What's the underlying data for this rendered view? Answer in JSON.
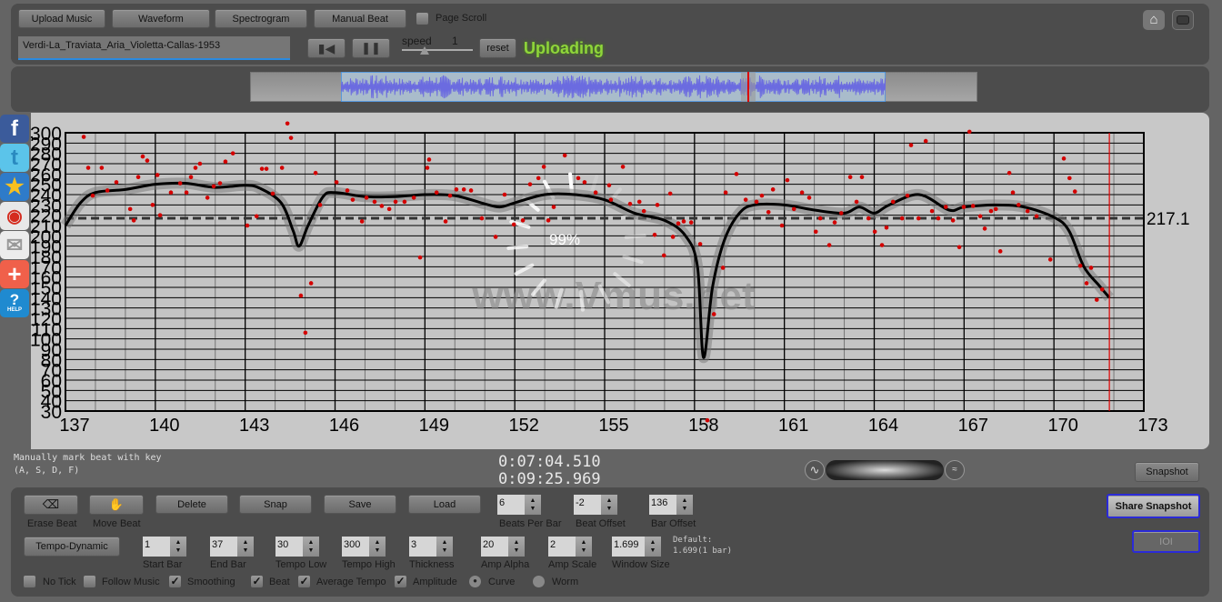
{
  "toolbar": {
    "upload_label": "Upload Music",
    "waveform_label": "Waveform",
    "spectrogram_label": "Spectrogram",
    "manual_beat_label": "Manual Beat",
    "page_scroll_label": "Page Scroll",
    "page_scroll_checked": false,
    "track_title": "Verdi-La_Traviata_Aria_Violetta-Callas-1953",
    "speed_label": "speed",
    "speed_value": "1",
    "reset_label": "reset",
    "status": "Uploading",
    "status_color": "#8fd63a"
  },
  "social": [
    "facebook-icon",
    "twitter-icon",
    "qzone-icon",
    "weibo-icon",
    "mail-icon",
    "add-icon",
    "help-icon"
  ],
  "social_help_text": "HELP",
  "overlay": {
    "progress": "99%",
    "watermark": "www.Vmus.net"
  },
  "info": {
    "hint_line1": "Manually mark beat with key",
    "hint_line2": "(A, S, D, F)",
    "current_time": "0:07:04.510",
    "total_time": "0:09:25.969",
    "snapshot_label": "Snapshot"
  },
  "controls": {
    "erase_beat": "Erase Beat",
    "move_beat": "Move Beat",
    "delete": "Delete",
    "snap": "Snap",
    "save": "Save",
    "load": "Load",
    "tempo_dynamic": "Tempo-Dynamic",
    "share_snapshot": "Share Snapshot",
    "ioi": "IOI",
    "default_line1": "Default:",
    "default_line2": "1.699(1 bar)",
    "spins1": [
      {
        "label": "Beats Per Bar",
        "value": "6"
      },
      {
        "label": "Beat Offset",
        "value": "-2"
      },
      {
        "label": "Bar Offset",
        "value": "136"
      }
    ],
    "spins2": [
      {
        "label": "Start Bar",
        "value": "1"
      },
      {
        "label": "End Bar",
        "value": "37"
      },
      {
        "label": "Tempo Low",
        "value": "30"
      },
      {
        "label": "Tempo High",
        "value": "300"
      },
      {
        "label": "Thickness",
        "value": "3"
      },
      {
        "label": "Amp Alpha",
        "value": "20"
      },
      {
        "label": "Amp Scale",
        "value": "2"
      },
      {
        "label": "Window Size",
        "value": "1.699"
      }
    ],
    "checks": [
      {
        "label": "No Tick",
        "checked": false
      },
      {
        "label": "Follow Music",
        "checked": false
      },
      {
        "label": "Smoothing",
        "checked": true
      },
      {
        "label": "Beat",
        "checked": true
      },
      {
        "label": "Average Tempo",
        "checked": true
      },
      {
        "label": "Amplitude",
        "checked": true
      }
    ],
    "radios": [
      {
        "label": "Curve",
        "selected": true
      },
      {
        "label": "Worm",
        "selected": false
      }
    ]
  },
  "chart_data": {
    "type": "line",
    "xlim": [
      137,
      173
    ],
    "ylim": [
      30,
      300
    ],
    "x_ticks": [
      137,
      140,
      143,
      146,
      149,
      152,
      155,
      158,
      161,
      164,
      167,
      170,
      173
    ],
    "y_ticks": [
      30,
      40,
      50,
      60,
      70,
      80,
      90,
      100,
      110,
      120,
      130,
      140,
      150,
      160,
      170,
      180,
      190,
      200,
      210,
      220,
      230,
      240,
      250,
      260,
      270,
      280,
      290,
      300
    ],
    "grid": true,
    "average_tempo": 217.1,
    "average_label": "217.1",
    "playhead_bar": 171.85,
    "colors": {
      "curve": "#000000",
      "beats": "#d40000",
      "playhead": "#e00000",
      "average": "#333333"
    },
    "tempo_curve": [
      [
        137,
        210
      ],
      [
        137.5,
        232
      ],
      [
        138,
        242
      ],
      [
        139,
        245
      ],
      [
        140,
        250
      ],
      [
        141,
        251
      ],
      [
        142,
        247
      ],
      [
        143,
        249
      ],
      [
        143.5,
        246
      ],
      [
        144.2,
        232
      ],
      [
        144.6,
        205
      ],
      [
        144.8,
        190
      ],
      [
        145.1,
        210
      ],
      [
        145.6,
        238
      ],
      [
        146,
        242
      ],
      [
        147,
        238
      ],
      [
        148,
        238
      ],
      [
        149,
        240
      ],
      [
        150,
        239
      ],
      [
        151,
        231
      ],
      [
        151.5,
        228
      ],
      [
        152,
        232
      ],
      [
        153,
        240
      ],
      [
        154,
        240
      ],
      [
        155,
        235
      ],
      [
        156,
        222
      ],
      [
        157,
        215
      ],
      [
        157.7,
        200
      ],
      [
        158.1,
        170
      ],
      [
        158.3,
        82
      ],
      [
        158.6,
        150
      ],
      [
        159,
        196
      ],
      [
        159.5,
        222
      ],
      [
        160,
        230
      ],
      [
        161,
        230
      ],
      [
        162,
        225
      ],
      [
        163,
        222
      ],
      [
        163.5,
        228
      ],
      [
        164,
        222
      ],
      [
        164.5,
        230
      ],
      [
        165.5,
        240
      ],
      [
        166.5,
        225
      ],
      [
        167,
        228
      ],
      [
        168,
        230
      ],
      [
        169,
        228
      ],
      [
        170,
        218
      ],
      [
        170.5,
        205
      ],
      [
        171,
        170
      ],
      [
        171.5,
        152
      ],
      [
        171.85,
        140
      ]
    ],
    "beats": [
      [
        137.61,
        296
      ],
      [
        137.76,
        266
      ],
      [
        137.91,
        239
      ],
      [
        138.21,
        266
      ],
      [
        138.4,
        244
      ],
      [
        138.7,
        252
      ],
      [
        139.16,
        226
      ],
      [
        139.28,
        215
      ],
      [
        139.43,
        257
      ],
      [
        139.58,
        277
      ],
      [
        139.73,
        273
      ],
      [
        139.91,
        230
      ],
      [
        140.07,
        259
      ],
      [
        140.16,
        220
      ],
      [
        140.52,
        242
      ],
      [
        140.83,
        251
      ],
      [
        141.04,
        242
      ],
      [
        141.19,
        257
      ],
      [
        141.34,
        266
      ],
      [
        141.49,
        270
      ],
      [
        141.74,
        237
      ],
      [
        141.95,
        248
      ],
      [
        142.16,
        251
      ],
      [
        142.34,
        272
      ],
      [
        142.59,
        280
      ],
      [
        143.07,
        210
      ],
      [
        143.38,
        219
      ],
      [
        143.56,
        265
      ],
      [
        143.71,
        265
      ],
      [
        143.92,
        241
      ],
      [
        144.23,
        266
      ],
      [
        144.41,
        309
      ],
      [
        144.53,
        295
      ],
      [
        144.86,
        142
      ],
      [
        145.01,
        106
      ],
      [
        145.2,
        154
      ],
      [
        145.35,
        261
      ],
      [
        145.5,
        230
      ],
      [
        146.05,
        252
      ],
      [
        146.41,
        244
      ],
      [
        146.59,
        235
      ],
      [
        146.9,
        214
      ],
      [
        147.05,
        237
      ],
      [
        147.32,
        233
      ],
      [
        147.56,
        229
      ],
      [
        147.81,
        226
      ],
      [
        148.02,
        233
      ],
      [
        148.32,
        233
      ],
      [
        148.63,
        237
      ],
      [
        148.84,
        179
      ],
      [
        149.08,
        266
      ],
      [
        149.14,
        274
      ],
      [
        149.39,
        242
      ],
      [
        149.69,
        214
      ],
      [
        149.84,
        239
      ],
      [
        150.05,
        245
      ],
      [
        150.3,
        245
      ],
      [
        150.54,
        244
      ],
      [
        150.9,
        217
      ],
      [
        151.36,
        199
      ],
      [
        151.66,
        240
      ],
      [
        151.97,
        211
      ],
      [
        152.27,
        215
      ],
      [
        152.51,
        250
      ],
      [
        152.79,
        256
      ],
      [
        152.97,
        267
      ],
      [
        153.12,
        215
      ],
      [
        153.3,
        228
      ],
      [
        153.67,
        278
      ],
      [
        154.12,
        256
      ],
      [
        154.33,
        252
      ],
      [
        154.7,
        242
      ],
      [
        155.15,
        249
      ],
      [
        155.21,
        235
      ],
      [
        155.61,
        267
      ],
      [
        155.85,
        231
      ],
      [
        156.16,
        233
      ],
      [
        156.31,
        224
      ],
      [
        156.67,
        201
      ],
      [
        156.76,
        230
      ],
      [
        156.98,
        181
      ],
      [
        157.19,
        241
      ],
      [
        157.28,
        199
      ],
      [
        157.46,
        212
      ],
      [
        157.64,
        214
      ],
      [
        157.89,
        213
      ],
      [
        158.19,
        192
      ],
      [
        158.43,
        21
      ],
      [
        158.65,
        124
      ],
      [
        158.95,
        169
      ],
      [
        159.04,
        242
      ],
      [
        159.4,
        260
      ],
      [
        159.71,
        235
      ],
      [
        160.07,
        233
      ],
      [
        160.25,
        239
      ],
      [
        160.47,
        223
      ],
      [
        160.62,
        245
      ],
      [
        160.92,
        210
      ],
      [
        161.1,
        254
      ],
      [
        161.32,
        226
      ],
      [
        161.59,
        242
      ],
      [
        161.83,
        237
      ],
      [
        162.05,
        204
      ],
      [
        162.2,
        217
      ],
      [
        162.5,
        191
      ],
      [
        162.68,
        213
      ],
      [
        162.9,
        222
      ],
      [
        163.2,
        257
      ],
      [
        163.41,
        233
      ],
      [
        163.59,
        257
      ],
      [
        163.81,
        217
      ],
      [
        164.02,
        204
      ],
      [
        164.26,
        191
      ],
      [
        164.41,
        208
      ],
      [
        164.63,
        233
      ],
      [
        164.93,
        217
      ],
      [
        165.11,
        239
      ],
      [
        165.23,
        288
      ],
      [
        165.48,
        217
      ],
      [
        165.72,
        292
      ],
      [
        165.93,
        224
      ],
      [
        166.14,
        217
      ],
      [
        166.39,
        228
      ],
      [
        166.63,
        215
      ],
      [
        166.84,
        189
      ],
      [
        166.99,
        228
      ],
      [
        167.18,
        301
      ],
      [
        167.3,
        229
      ],
      [
        167.54,
        219
      ],
      [
        167.69,
        207
      ],
      [
        167.9,
        224
      ],
      [
        168.06,
        226
      ],
      [
        168.21,
        185
      ],
      [
        168.51,
        261
      ],
      [
        168.63,
        242
      ],
      [
        168.82,
        230
      ],
      [
        169.12,
        224
      ],
      [
        169.42,
        219
      ],
      [
        169.88,
        177
      ],
      [
        170.33,
        275
      ],
      [
        170.52,
        256
      ],
      [
        170.7,
        243
      ],
      [
        170.88,
        171
      ],
      [
        171.09,
        154
      ],
      [
        171.24,
        169
      ],
      [
        171.43,
        138
      ],
      [
        171.61,
        148
      ]
    ]
  }
}
